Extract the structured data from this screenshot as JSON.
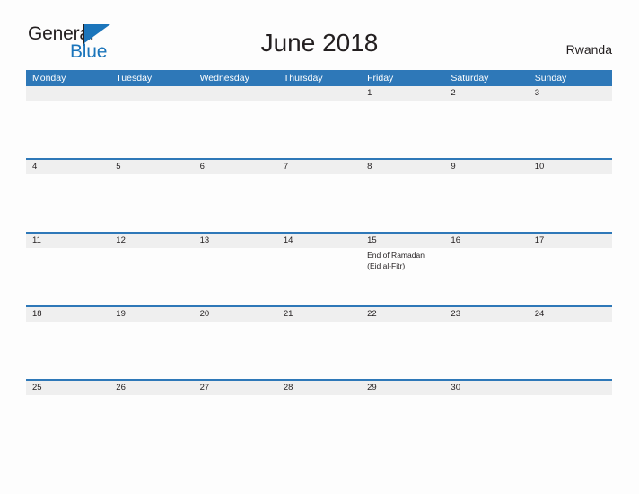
{
  "brand": {
    "name_part1": "General",
    "name_part2": "Blue",
    "flag_icon": "triangle-flag-icon",
    "color_primary": "#1b75bb",
    "color_text": "#231f20"
  },
  "header": {
    "title": "June 2018",
    "country": "Rwanda"
  },
  "calendar": {
    "header_bg": "#2e78b8",
    "date_band_bg": "#efefef",
    "day_names": [
      "Monday",
      "Tuesday",
      "Wednesday",
      "Thursday",
      "Friday",
      "Saturday",
      "Sunday"
    ],
    "weeks": [
      {
        "dates": [
          "",
          "",
          "",
          "",
          "1",
          "2",
          "3"
        ],
        "events": [
          [],
          [],
          [],
          [],
          [],
          [],
          []
        ]
      },
      {
        "dates": [
          "4",
          "5",
          "6",
          "7",
          "8",
          "9",
          "10"
        ],
        "events": [
          [],
          [],
          [],
          [],
          [],
          [],
          []
        ]
      },
      {
        "dates": [
          "11",
          "12",
          "13",
          "14",
          "15",
          "16",
          "17"
        ],
        "events": [
          [],
          [],
          [],
          [],
          [
            "End of Ramadan",
            "(Eid al-Fitr)"
          ],
          [],
          []
        ]
      },
      {
        "dates": [
          "18",
          "19",
          "20",
          "21",
          "22",
          "23",
          "24"
        ],
        "events": [
          [],
          [],
          [],
          [],
          [],
          [],
          []
        ]
      },
      {
        "dates": [
          "25",
          "26",
          "27",
          "28",
          "29",
          "30",
          ""
        ],
        "events": [
          [],
          [],
          [],
          [],
          [],
          [],
          []
        ]
      }
    ]
  }
}
